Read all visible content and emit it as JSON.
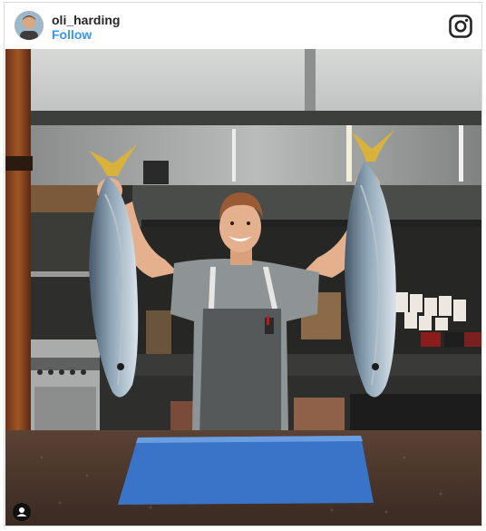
{
  "post": {
    "username": "oli_harding",
    "follow_label": "Follow"
  },
  "icons": {
    "brand": "instagram-icon",
    "tag": "user-tag-icon"
  },
  "colors": {
    "link": "#3897f0",
    "text": "#262626",
    "border": "#dbdbdb",
    "board": "#3a74c8"
  }
}
